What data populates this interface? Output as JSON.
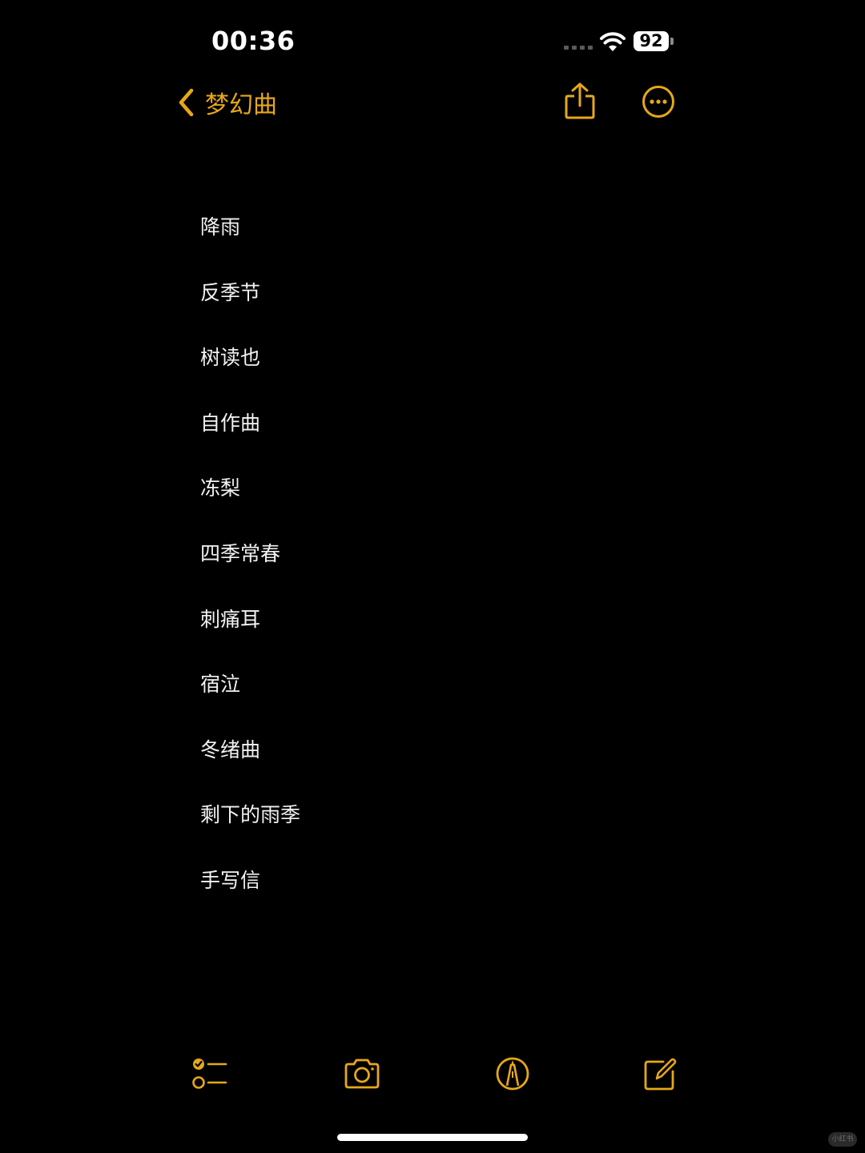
{
  "status_bar": {
    "time": "00:36",
    "battery": "92",
    "signal_icon": "cellular-signal-icon",
    "wifi_icon": "wifi-icon"
  },
  "nav": {
    "back_label": "梦幻曲",
    "back_icon": "chevron-left-icon",
    "share_icon": "share-icon",
    "more_icon": "ellipsis-circle-icon",
    "accent_color": "#e6a817"
  },
  "note": {
    "lines": [
      "降雨",
      "反季节",
      "树读也",
      "自作曲",
      "冻梨",
      "四季常春",
      "刺痛耳",
      "宿泣",
      "冬绪曲",
      "剩下的雨季",
      "手写信"
    ]
  },
  "toolbar": {
    "checklist_icon": "checklist-icon",
    "camera_icon": "camera-icon",
    "markup_icon": "markup-pen-icon",
    "compose_icon": "compose-icon"
  },
  "watermark": "小红书"
}
